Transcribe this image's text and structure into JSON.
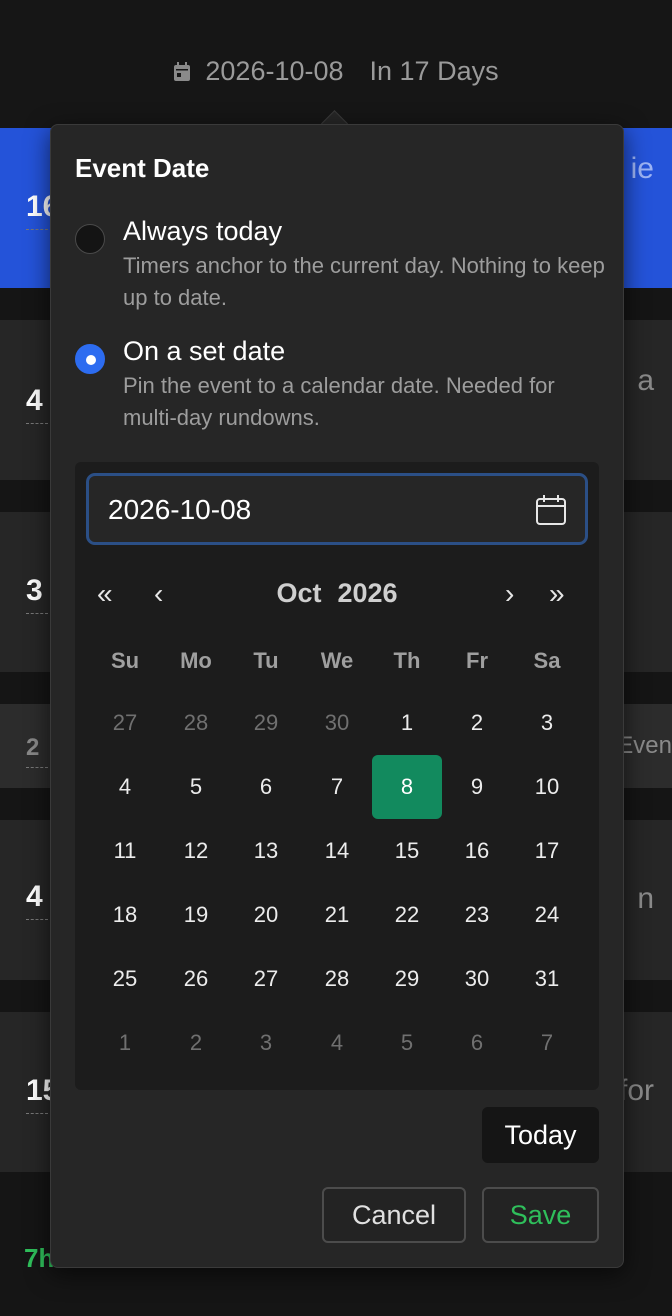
{
  "header": {
    "date": "2026-10-08",
    "relative": "In 17 Days"
  },
  "background": {
    "rows_left": [
      "16",
      "4",
      "3",
      "2",
      "4",
      "15"
    ],
    "rows_right": [
      "ie",
      "a",
      "",
      "Even",
      "n",
      "for"
    ],
    "footer_green": "7h"
  },
  "popover": {
    "title": "Event Date",
    "options": [
      {
        "label": "Always today",
        "description": "Timers anchor to the current day. Nothing to keep up to date.",
        "selected": false
      },
      {
        "label": "On a set date",
        "description": "Pin the event to a calendar date. Needed for multi-day rundowns.",
        "selected": true
      }
    ],
    "date_input_value": "2026-10-08",
    "calendar": {
      "month": "Oct",
      "year": "2026",
      "nav": {
        "prev_year": "«",
        "prev_month": "‹",
        "next_month": "›",
        "next_year": "»"
      },
      "weekdays": [
        "Su",
        "Mo",
        "Tu",
        "We",
        "Th",
        "Fr",
        "Sa"
      ],
      "weeks": [
        [
          "27",
          "28",
          "29",
          "30",
          "1",
          "2",
          "3"
        ],
        [
          "4",
          "5",
          "6",
          "7",
          "8",
          "9",
          "10"
        ],
        [
          "11",
          "12",
          "13",
          "14",
          "15",
          "16",
          "17"
        ],
        [
          "18",
          "19",
          "20",
          "21",
          "22",
          "23",
          "24"
        ],
        [
          "25",
          "26",
          "27",
          "28",
          "29",
          "30",
          "31"
        ],
        [
          "1",
          "2",
          "3",
          "4",
          "5",
          "6",
          "7"
        ]
      ],
      "selected_day": "8",
      "colors": {
        "selected": "#128a5e",
        "accent": "#2d6cf0"
      }
    },
    "today_label": "Today",
    "cancel_label": "Cancel",
    "save_label": "Save"
  }
}
